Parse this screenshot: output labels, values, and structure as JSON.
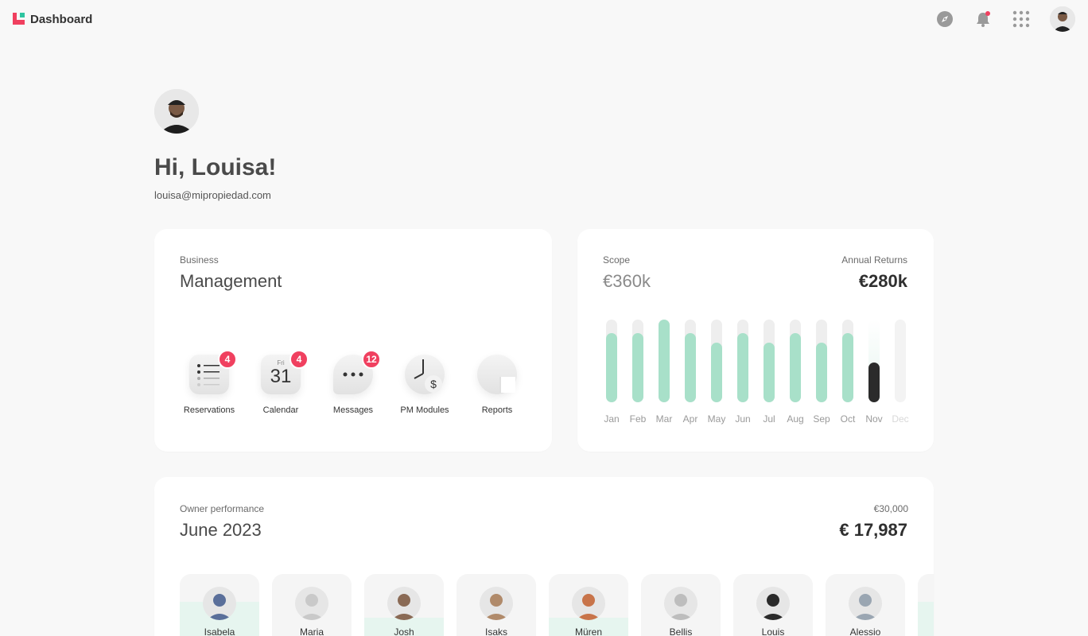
{
  "header": {
    "title": "Dashboard",
    "icons": [
      "explore-icon",
      "bell-icon",
      "apps-grid-icon"
    ]
  },
  "profile": {
    "greeting": "Hi, Louisa!",
    "email": "louisa@mipropiedad.com"
  },
  "management": {
    "overline": "Business",
    "title": "Management",
    "modules": [
      {
        "label": "Reservations",
        "badge": "4",
        "icon": "list-icon"
      },
      {
        "label": "Calendar",
        "badge": "4",
        "icon": "calendar-icon",
        "day": "Fri",
        "date": "31"
      },
      {
        "label": "Messages",
        "badge": "12",
        "icon": "chat-icon"
      },
      {
        "label": "PM Modules",
        "badge": "",
        "icon": "clock-dollar-icon"
      },
      {
        "label": "Reports",
        "badge": "",
        "icon": "pie-icon"
      }
    ]
  },
  "scope": {
    "label": "Scope",
    "value": "€360k",
    "returns_label": "Annual Returns",
    "returns_value": "€280k"
  },
  "chart_data": {
    "type": "bar",
    "categories": [
      "Jan",
      "Feb",
      "Mar",
      "Apr",
      "May",
      "Jun",
      "Jul",
      "Aug",
      "Sep",
      "Oct",
      "Nov",
      "Dec"
    ],
    "values": [
      0.84,
      0.84,
      1.0,
      0.84,
      0.72,
      0.84,
      0.72,
      0.84,
      0.72,
      0.84,
      0.48,
      0
    ],
    "highlight": "Nov",
    "colors": {
      "bar": "#a8e0c9",
      "track": "#eeeeee",
      "highlight": "#2b2b2b"
    }
  },
  "owner": {
    "label": "Owner performance",
    "period": "June 2023",
    "target": "€30,000",
    "value": "€ 17,987",
    "owners": [
      {
        "name": "Isabela",
        "stripe": 0.65,
        "color": "#5a6f9a"
      },
      {
        "name": "Maria",
        "stripe": 0.2,
        "color": "#c9c9c9"
      },
      {
        "name": "Josh",
        "stripe": 0.45,
        "color": "#8a6a55"
      },
      {
        "name": "Isaks",
        "stripe": 0.2,
        "color": "#b08a6a"
      },
      {
        "name": "Müren",
        "stripe": 0.45,
        "color": "#c8744a"
      },
      {
        "name": "Bellis",
        "stripe": 0.2,
        "color": "#bdbdbd"
      },
      {
        "name": "Louis",
        "stripe": 0.2,
        "color": "#2a2a2a"
      },
      {
        "name": "Alessio",
        "stripe": 0.2,
        "color": "#9aa6b2"
      }
    ]
  }
}
